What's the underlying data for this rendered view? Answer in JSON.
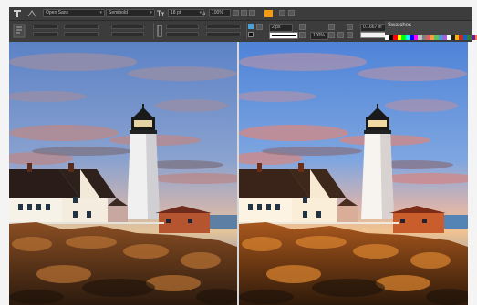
{
  "toolbar": {
    "font_family": "Open Sans",
    "font_style": "Semibold",
    "font_size": "18 pt",
    "tracking": "100%",
    "width_value": "2 px",
    "zoom_value": "100%",
    "dimension_value": "0.1667 in",
    "text_tool_icon": "text-tool-icon"
  },
  "panel": {
    "title": "Swatches",
    "colors": [
      "#ffffff",
      "#000000",
      "#ff0000",
      "#ffff00",
      "#00ff00",
      "#00ffff",
      "#0000ff",
      "#ff00ff",
      "#c0c0c0",
      "#808080",
      "#e06060",
      "#f0a040",
      "#60c060",
      "#40a0e0",
      "#a060e0",
      "#f8f8f8",
      "#202020",
      "#f4b400",
      "#c62828",
      "#1565c0",
      "#2e7d32",
      "#6a1b9a",
      "#ff7043"
    ]
  },
  "accent_color": "#f39c12",
  "images": {
    "left": "original photo",
    "right": "adjusted photo"
  }
}
